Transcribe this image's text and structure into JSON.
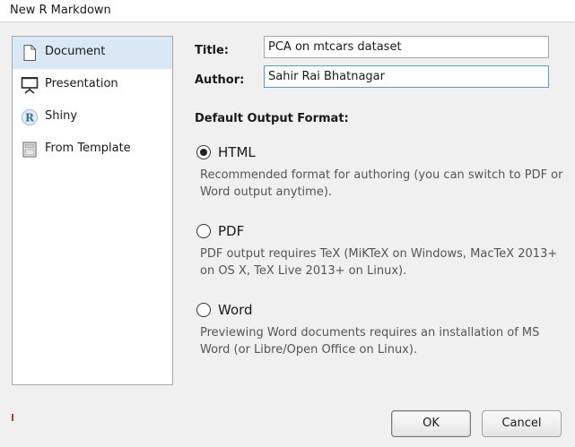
{
  "window": {
    "title": "New R Markdown"
  },
  "sidebar": {
    "items": [
      {
        "label": "Document",
        "icon": "document-icon",
        "selected": true
      },
      {
        "label": "Presentation",
        "icon": "presentation-icon",
        "selected": false
      },
      {
        "label": "Shiny",
        "icon": "shiny-icon",
        "selected": false
      },
      {
        "label": "From Template",
        "icon": "template-icon",
        "selected": false
      }
    ]
  },
  "form": {
    "title_label": "Title:",
    "title_value": "PCA on mtcars dataset",
    "author_label": "Author:",
    "author_value": "Sahir Rai Bhatnagar"
  },
  "output": {
    "heading": "Default Output Format:",
    "options": [
      {
        "label": "HTML",
        "selected": true,
        "desc_lines": [
          "Recommended format for authoring (you can switch to PDF or",
          "Word output anytime)."
        ]
      },
      {
        "label": "PDF",
        "selected": false,
        "desc_lines": [
          "PDF output requires TeX (MiKTeX on Windows, MacTeX 2013+",
          "on OS X, TeX Live 2013+ on Linux)."
        ]
      },
      {
        "label": "Word",
        "selected": false,
        "desc_lines": [
          "Previewing Word documents requires an installation of MS",
          "Word (or Libre/Open Office on Linux)."
        ]
      }
    ]
  },
  "buttons": {
    "ok_label": "OK",
    "cancel_label": "Cancel"
  },
  "colors": {
    "selected_item_bg": "#dae7f4",
    "focus_border": "#5b9bd5"
  }
}
